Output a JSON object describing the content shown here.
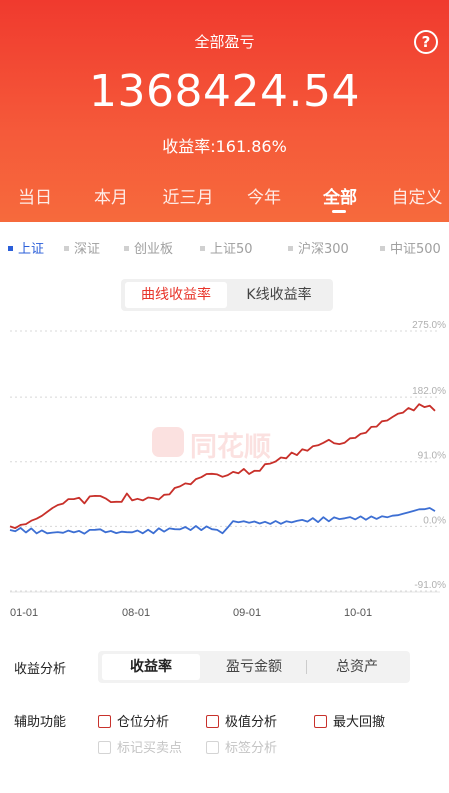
{
  "header": {
    "title": "全部盈亏",
    "help_icon": "?",
    "amount": "1368424.54",
    "rate_text": "收益率:161.86%",
    "periods": [
      "当日",
      "本月",
      "近三月",
      "今年",
      "全部",
      "自定义"
    ],
    "active_period": "全部"
  },
  "index_tabs": [
    "上证",
    "深证",
    "创业板",
    "上证50",
    "沪深300",
    "中证500"
  ],
  "active_index": "上证",
  "chart_toggle": {
    "curve": "曲线收益率",
    "kline": "K线收益率"
  },
  "watermark": "同花顺",
  "chart_data": {
    "type": "line",
    "y_tick_labels": [
      "275.0%",
      "182.0%",
      "91.0%",
      "0.0%",
      "-91.0%"
    ],
    "y_ticks": [
      275,
      182,
      91,
      0,
      -91
    ],
    "ylim": [
      -91,
      275
    ],
    "x_tick_labels": [
      "01-01",
      "08-01",
      "09-01",
      "10-01"
    ],
    "x": [
      0,
      1,
      2,
      3,
      4,
      5,
      6,
      7,
      8,
      9,
      10,
      11,
      12,
      13,
      14,
      15,
      16,
      17,
      18,
      19,
      20,
      21,
      22,
      23,
      24,
      25,
      26,
      27,
      28,
      29,
      30,
      31,
      32,
      33,
      34,
      35,
      36,
      37,
      38,
      39,
      40
    ],
    "series": [
      {
        "color": "#c8302a",
        "values": [
          0,
          4,
          10,
          15,
          24,
          30,
          38,
          34,
          45,
          40,
          33,
          44,
          38,
          42,
          40,
          46,
          55,
          57,
          68,
          75,
          72,
          78,
          80,
          76,
          86,
          92,
          98,
          102,
          106,
          112,
          120,
          116,
          126,
          132,
          140,
          146,
          152,
          160,
          165,
          170,
          163
        ]
      },
      {
        "color": "#3d6fd3",
        "values": [
          -5,
          -4,
          -5,
          -6,
          -7,
          -7,
          -8,
          -12,
          -7,
          -9,
          -8,
          -6,
          -5,
          -6,
          -5,
          -4,
          -3,
          -3,
          -4,
          -5,
          -12,
          6,
          8,
          9,
          8,
          7,
          5,
          6,
          7,
          8,
          9,
          10,
          11,
          12,
          14,
          16,
          17,
          18,
          20,
          22,
          21
        ]
      }
    ],
    "grid": true
  },
  "analysis": {
    "label": "收益分析",
    "options": [
      "收益率",
      "盈亏金额",
      "总资产"
    ],
    "active": "收益率"
  },
  "aux": {
    "label": "辅助功能",
    "checkboxes": [
      "仓位分析",
      "极值分析",
      "最大回撤"
    ],
    "disabled": [
      "标记买卖点",
      "标签分析"
    ]
  },
  "colors": {
    "brand_red": "#f03a2e",
    "accent_blue": "#2b5fd9"
  }
}
